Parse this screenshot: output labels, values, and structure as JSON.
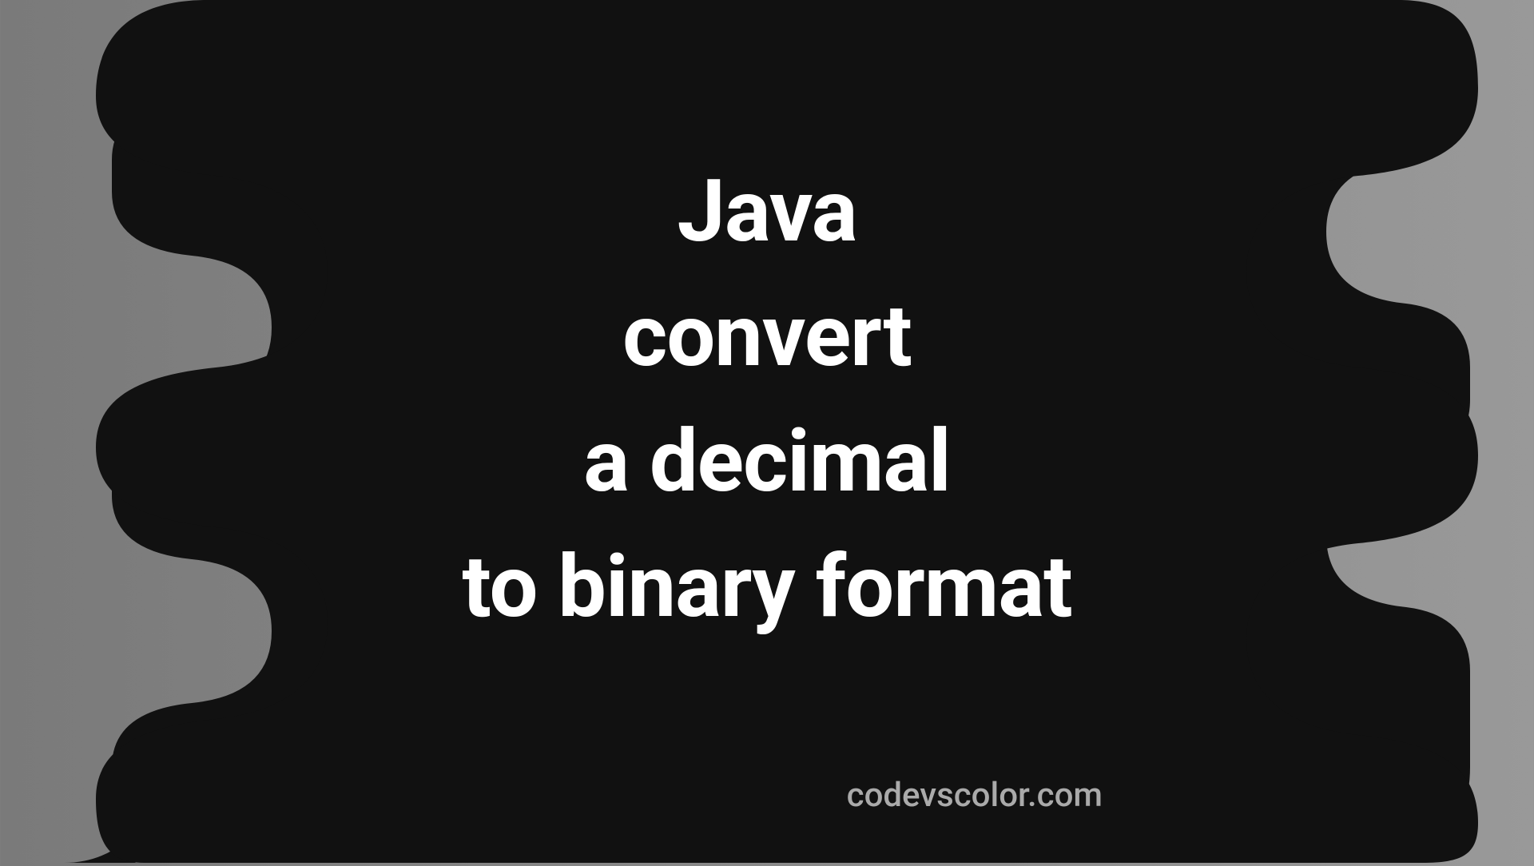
{
  "title": {
    "line1": "Java",
    "line2": "convert",
    "line3": "a decimal",
    "line4": "to binary format"
  },
  "watermark": "codevscolor.com",
  "colors": {
    "blob": "#111111",
    "text": "#ffffff",
    "watermark": "#aaaaaa",
    "bg_left": "#7a7a7a",
    "bg_right": "#999999"
  }
}
